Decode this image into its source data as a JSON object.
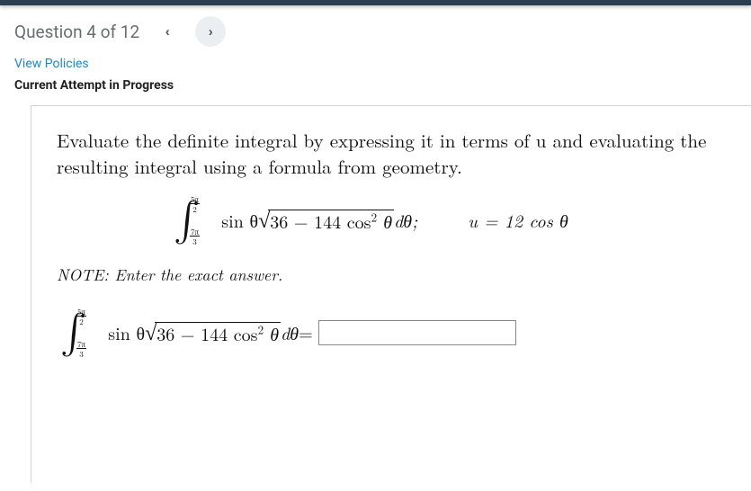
{
  "header": {
    "question_label": "Question 4 of 12",
    "prev_glyph": "‹",
    "next_glyph": "›"
  },
  "links": {
    "view_policies": "View Policies"
  },
  "status": {
    "current_attempt": "Current Attempt in Progress"
  },
  "question": {
    "prompt": "Evaluate the definite integral by expressing it in terms of u and evaluating the resulting integral using a formula from geometry.",
    "integral": {
      "upper_num": "5π",
      "upper_den": "2",
      "lower_num": "7π",
      "lower_den": "3",
      "integrand_pre": "sin θ",
      "sqrt_body_a": "36 − 144 cos",
      "sqrt_body_exp": "2",
      "sqrt_body_b": " θ",
      "dtheta": " dθ;"
    },
    "substitution": "u = 12 cos θ",
    "note": "NOTE: Enter the exact answer.",
    "answer_equals": " = "
  },
  "answer": {
    "value": "",
    "placeholder": ""
  }
}
